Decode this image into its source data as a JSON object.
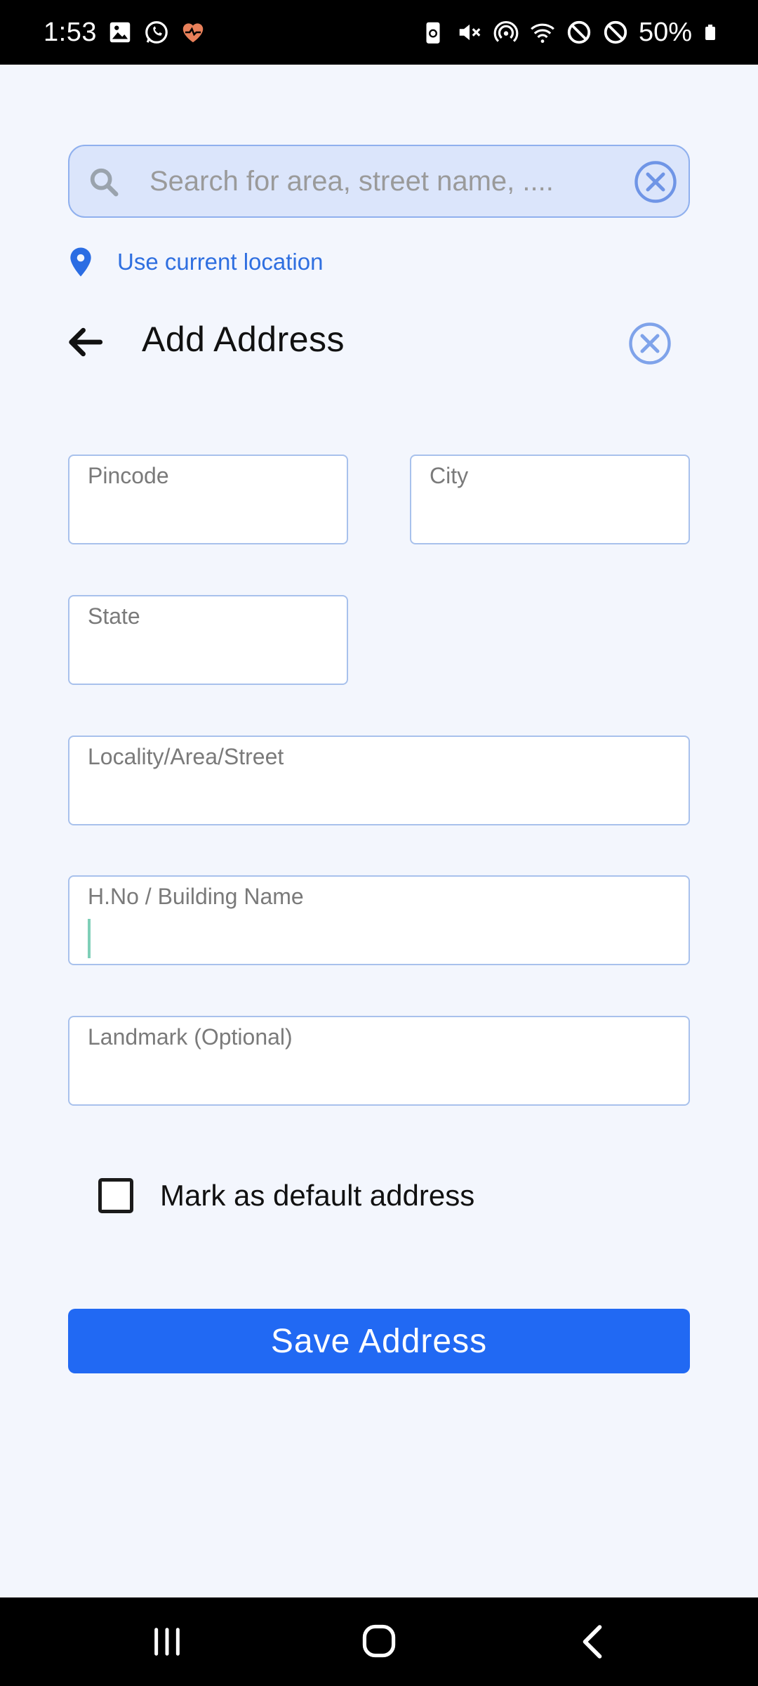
{
  "status_bar": {
    "time": "1:53",
    "battery_percent": "50%",
    "icons_left": [
      "gallery-icon",
      "whatsapp-icon",
      "health-icon"
    ],
    "icons_right": [
      "battery-saver-icon",
      "mute-icon",
      "hotspot-icon",
      "wifi-icon",
      "dnd-icon",
      "blocked-icon",
      "battery-icon"
    ]
  },
  "search": {
    "placeholder": "Search for area, street name, ....",
    "value": ""
  },
  "location": {
    "label": "Use current location"
  },
  "header": {
    "title": "Add Address"
  },
  "form": {
    "pincode": {
      "label": "Pincode",
      "value": ""
    },
    "city": {
      "label": "City",
      "value": ""
    },
    "state": {
      "label": "State",
      "value": ""
    },
    "locality": {
      "label": "Locality/Area/Street",
      "value": ""
    },
    "building": {
      "label": "H.No / Building Name",
      "value": "",
      "focused": true
    },
    "landmark": {
      "label": "Landmark (Optional)",
      "value": ""
    },
    "default_checkbox": {
      "label": "Mark as default address",
      "checked": false
    },
    "save_label": "Save Address"
  },
  "colors": {
    "background": "#f3f6fd",
    "accent": "#2169f3",
    "link": "#2f6fe0",
    "field_border": "#a8c1ec",
    "search_bg": "#dbe5fb"
  }
}
